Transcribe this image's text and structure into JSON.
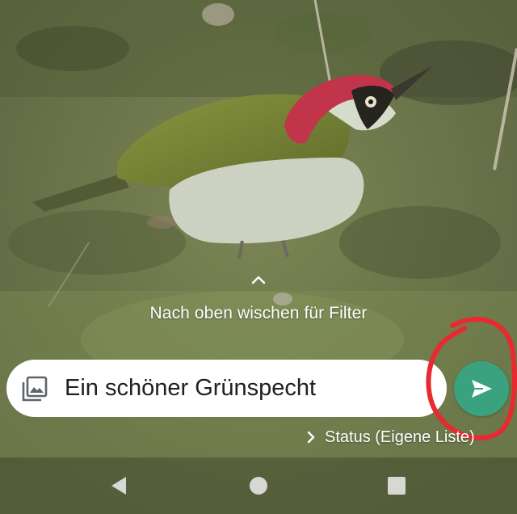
{
  "photo": {
    "subject": "green-woodpecker-on-lawn",
    "colors": {
      "grass": "#6f7a4c",
      "bird_back": "#7d8a3a",
      "bird_belly": "#cfd3c4",
      "bird_crown": "#c2344a",
      "bird_mask": "#26241f"
    }
  },
  "hint": {
    "icon": "chevron-up-icon",
    "text": "Nach oben wischen für Filter"
  },
  "caption": {
    "icon": "gallery-icon",
    "value": "Ein schöner Grünspecht"
  },
  "send": {
    "icon": "send-icon",
    "color": "#3aa27e",
    "annotation_color": "#e8292f"
  },
  "status": {
    "icon": "chevron-right-icon",
    "label": "Status (Eigene Liste)"
  },
  "navigation": {
    "back": "back-triangle-icon",
    "home": "home-circle-icon",
    "recents": "recents-square-icon"
  }
}
